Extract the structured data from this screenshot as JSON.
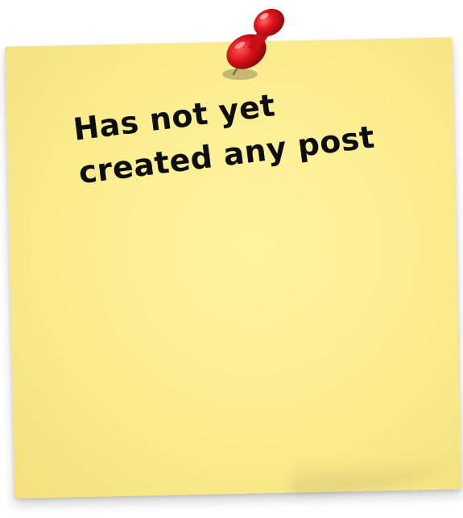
{
  "note": {
    "message": "Has not yet created any post",
    "color": "#fbec8e"
  },
  "pin": {
    "icon": "pushpin-icon",
    "color": "#e2141b"
  }
}
